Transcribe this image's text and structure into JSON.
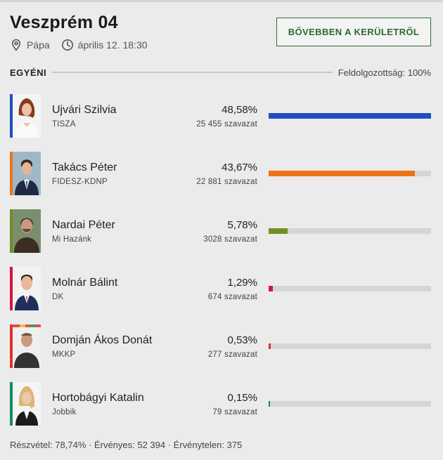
{
  "header": {
    "title": "Veszprém 04",
    "location": "Pápa",
    "datetime": "április 12. 18:30",
    "more_button": "BŐVEBBEN A KERÜLETRŐL"
  },
  "section": {
    "label": "EGYÉNI",
    "progress": "Feldolgozottság: 100%"
  },
  "candidates": [
    {
      "name": "Ujvári Szilvia",
      "party": "TISZA",
      "percent": "48,58%",
      "votes": "25 455 szavazat",
      "share": 1.0,
      "color": "#1f4fbf"
    },
    {
      "name": "Takács Péter",
      "party": "FIDESZ-KDNP",
      "percent": "43,67%",
      "votes": "22 881 szavazat",
      "share": 0.899,
      "color": "#f07218"
    },
    {
      "name": "Nardai Péter",
      "party": "Mi Hazánk",
      "percent": "5,78%",
      "votes": "3028 szavazat",
      "share": 0.119,
      "color": "#6f8f26"
    },
    {
      "name": "Molnár Bálint",
      "party": "DK",
      "percent": "1,29%",
      "votes": "674 szavazat",
      "share": 0.027,
      "color": "#d4163c"
    },
    {
      "name": "Domján Ákos Donát",
      "party": "MKKP",
      "percent": "0,53%",
      "votes": "277 szavazat",
      "share": 0.011,
      "color": "#e0302f"
    },
    {
      "name": "Hortobágyi Katalin",
      "party": "Jobbik",
      "percent": "0,15%",
      "votes": "79 szavazat",
      "share": 0.003,
      "color": "#128a6c"
    }
  ],
  "footer": {
    "summary": "Részvétel: 78,74% · Érvényes: 52 394 · Érvénytelen: 375"
  },
  "icons": {
    "location": "map-pin-icon",
    "time": "clock-icon"
  }
}
